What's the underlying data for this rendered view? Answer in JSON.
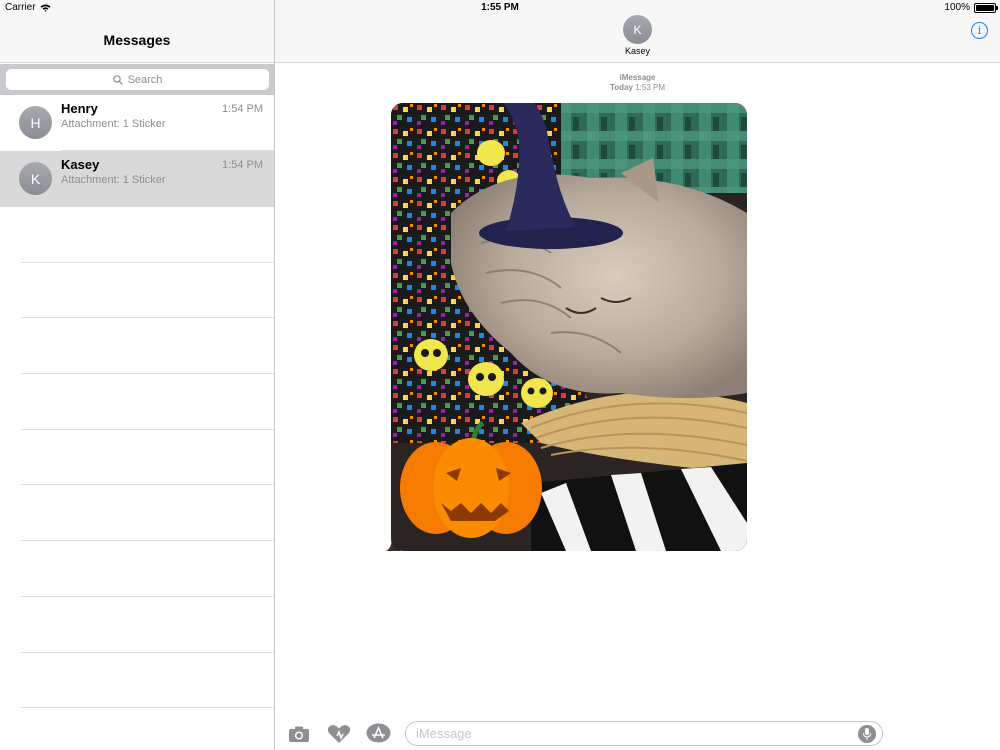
{
  "status_bar": {
    "carrier": "Carrier",
    "time": "1:55 PM",
    "battery": "100%",
    "battery_level": 1.0
  },
  "sidebar": {
    "title": "Messages",
    "search_placeholder": "Search",
    "conversations": [
      {
        "initial": "H",
        "name": "Henry",
        "preview": "Attachment: 1 Sticker",
        "time": "1:54 PM",
        "selected": false
      },
      {
        "initial": "K",
        "name": "Kasey",
        "preview": "Attachment: 1 Sticker",
        "time": "1:54 PM",
        "selected": true
      }
    ]
  },
  "chat": {
    "contact_initial": "K",
    "contact_name": "Kasey",
    "service": "iMessage",
    "day": "Today",
    "timestamp": "1:53 PM",
    "input_placeholder": "iMessage"
  },
  "colors": {
    "accent": "#1a82fb",
    "selected_row": "#d9d9d9",
    "header_bg": "#f7f7f7"
  },
  "icons": [
    "wifi-icon",
    "search-icon",
    "info-icon",
    "camera-icon",
    "digital-touch-icon",
    "app-store-icon",
    "microphone-icon"
  ]
}
